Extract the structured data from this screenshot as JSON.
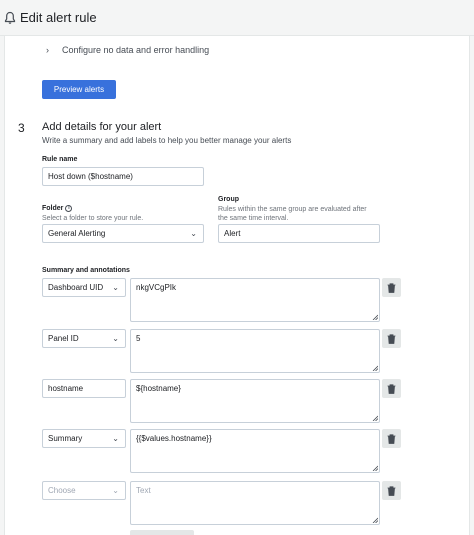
{
  "header": {
    "title": "Edit alert rule",
    "icon": "bell-icon"
  },
  "collapsible": {
    "label": "Configure no data and error handling",
    "icon": "chevron-right-icon"
  },
  "preview_button": {
    "label": "Preview alerts",
    "color": "#3871dc"
  },
  "section": {
    "step_number": "3",
    "title": "Add details for your alert",
    "description": "Write a summary and add labels to help you better manage your alerts"
  },
  "rule_name": {
    "label": "Rule name",
    "value": "Host down ($hostname)"
  },
  "folder": {
    "label": "Folder",
    "description": "Select a folder to store your rule.",
    "value": "General Alerting"
  },
  "group": {
    "label": "Group",
    "description_line1": "Rules within the same group are evaluated after",
    "description_line2": "the same time interval.",
    "value": "Alert"
  },
  "annotations": {
    "label": "Summary and annotations",
    "rows": [
      {
        "key": "Dashboard UID",
        "key_type": "select",
        "value": "nkgVCgPIk"
      },
      {
        "key": "Panel ID",
        "key_type": "select",
        "value": "5"
      },
      {
        "key": "hostname",
        "key_type": "input",
        "value": "${hostname}"
      },
      {
        "key": "Summary",
        "key_type": "select",
        "value": "{{$values.hostname}}"
      },
      {
        "key": "Choose",
        "key_type": "select-placeholder",
        "value": "Text"
      }
    ]
  }
}
